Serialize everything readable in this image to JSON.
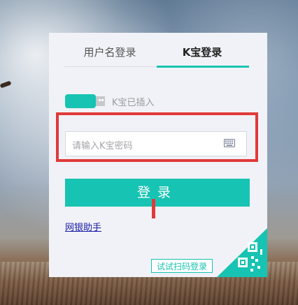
{
  "tabs": {
    "username_label": "用户名登录",
    "kbao_label": "K宝登录",
    "active": "K宝登录"
  },
  "usb": {
    "status": "K宝已插入",
    "icon": "usb-key-icon"
  },
  "password": {
    "placeholder": "请输入K宝密码",
    "value": "",
    "icon": "keyboard-icon"
  },
  "login_button": {
    "label": "登录"
  },
  "help_link": {
    "label": "网银助手"
  },
  "qr": {
    "tag": "试试扫码登录",
    "icon": "qr-code-icon"
  },
  "colors": {
    "accent": "#17c3b2",
    "highlight": "#e03a3a",
    "link": "#1a1aa8",
    "panel_bg": "#f1f2f7"
  }
}
